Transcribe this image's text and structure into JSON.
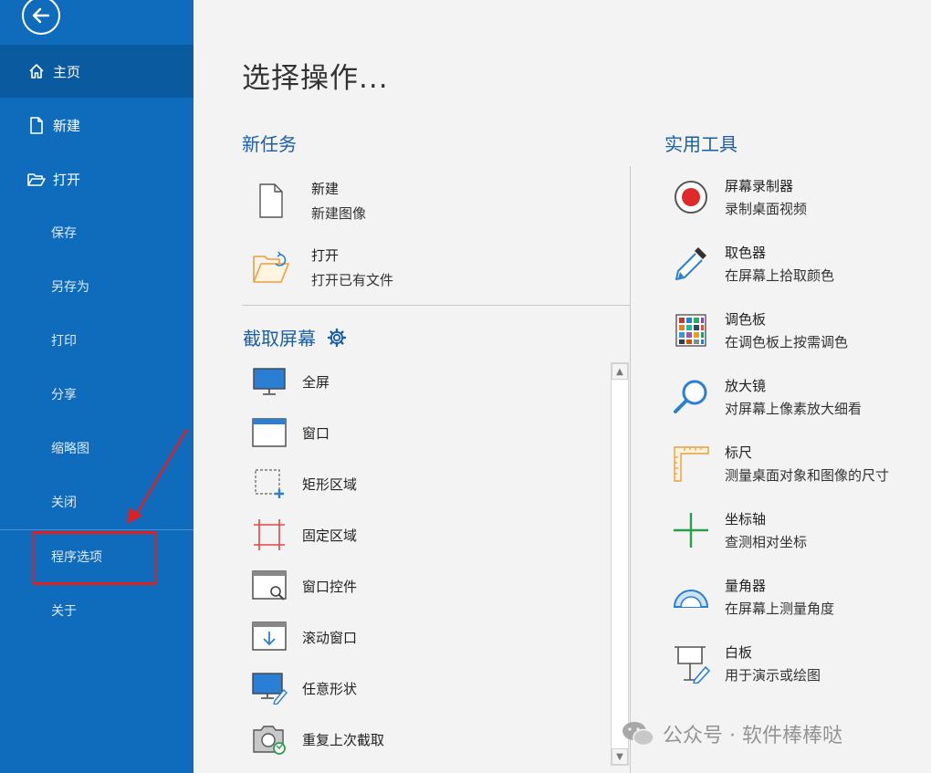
{
  "sidebar": {
    "items": [
      {
        "label": "主页",
        "icon": "home-icon"
      },
      {
        "label": "新建",
        "icon": "new-file-icon"
      },
      {
        "label": "打开",
        "icon": "folder-open-icon"
      },
      {
        "label": "保存"
      },
      {
        "label": "另存为"
      },
      {
        "label": "打印"
      },
      {
        "label": "分享"
      },
      {
        "label": "缩略图"
      },
      {
        "label": "关闭"
      },
      {
        "label": "程序选项"
      },
      {
        "label": "关于"
      }
    ]
  },
  "main": {
    "title": "选择操作...",
    "new_task": {
      "heading": "新任务",
      "items": [
        {
          "name": "新建",
          "desc": "新建图像"
        },
        {
          "name": "打开",
          "desc": "打开已有文件"
        }
      ]
    },
    "capture": {
      "heading": "截取屏幕",
      "items": [
        {
          "label": "全屏"
        },
        {
          "label": "窗口"
        },
        {
          "label": "矩形区域"
        },
        {
          "label": "固定区域"
        },
        {
          "label": "窗口控件"
        },
        {
          "label": "滚动窗口"
        },
        {
          "label": "任意形状"
        },
        {
          "label": "重复上次截取"
        }
      ]
    },
    "tools": {
      "heading": "实用工具",
      "items": [
        {
          "name": "屏幕录制器",
          "desc": "录制桌面视频"
        },
        {
          "name": "取色器",
          "desc": "在屏幕上拾取颜色"
        },
        {
          "name": "调色板",
          "desc": "在调色板上按需调色"
        },
        {
          "name": "放大镜",
          "desc": "对屏幕上像素放大细看"
        },
        {
          "name": "标尺",
          "desc": "测量桌面对象和图像的尺寸"
        },
        {
          "name": "坐标轴",
          "desc": "查测相对坐标"
        },
        {
          "name": "量角器",
          "desc": "在屏幕上测量角度"
        },
        {
          "name": "白板",
          "desc": "用于演示或绘图"
        }
      ]
    }
  },
  "watermark": {
    "text": "公众号 · 软件棒棒哒"
  },
  "colors": {
    "sidebar": "#0f6cbd",
    "accent": "#1a5fa8",
    "highlight": "#e02020"
  }
}
